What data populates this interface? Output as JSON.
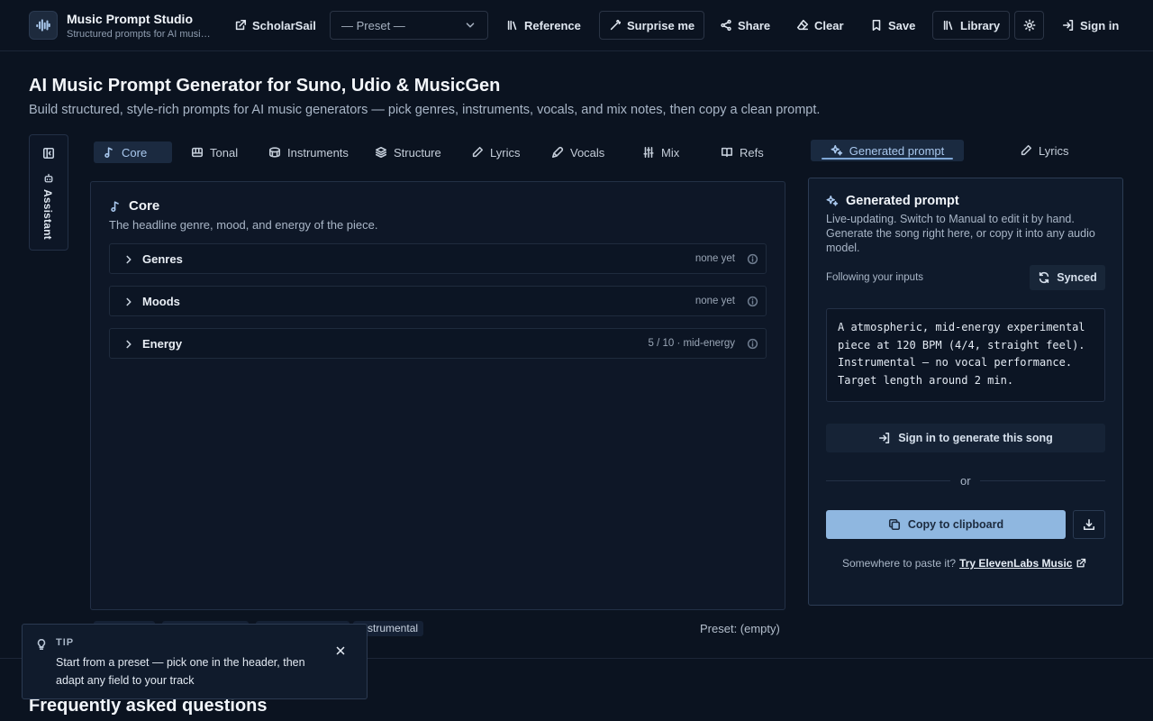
{
  "header": {
    "brand_title": "Music Prompt Studio",
    "brand_subtitle": "Structured prompts for AI music generators",
    "scholarsail_label": "ScholarSail",
    "preset_value": "— Preset —",
    "reference_label": "Reference",
    "surprise_label": "Surprise me",
    "share_label": "Share",
    "clear_label": "Clear",
    "save_label": "Save",
    "library_label": "Library",
    "signin_label": "Sign in"
  },
  "hero": {
    "title": "AI Music Prompt Generator for Suno, Udio & MusicGen",
    "subtitle": "Build structured, style-rich prompts for AI music generators — pick genres, instruments, vocals, and mix notes, then copy a clean prompt."
  },
  "assistant": {
    "label": "Assistant"
  },
  "tabs": [
    {
      "label": "Core",
      "icon": "music-note-icon",
      "active": true
    },
    {
      "label": "Tonal",
      "icon": "piano-icon"
    },
    {
      "label": "Instruments",
      "icon": "drum-icon"
    },
    {
      "label": "Structure",
      "icon": "layers-icon"
    },
    {
      "label": "Lyrics",
      "icon": "pen-icon"
    },
    {
      "label": "Vocals",
      "icon": "mic-icon"
    },
    {
      "label": "Mix",
      "icon": "sliders-icon"
    },
    {
      "label": "Refs",
      "icon": "book-icon"
    }
  ],
  "core": {
    "title": "Core",
    "subtitle": "The headline genre, mood, and energy of the piece.",
    "sections": [
      {
        "label": "Genres",
        "meta": "none yet"
      },
      {
        "label": "Moods",
        "meta": "none yet"
      },
      {
        "label": "Energy",
        "meta": "5 / 10 · mid-energy"
      }
    ]
  },
  "footer_chips": [
    "",
    "",
    "",
    "Instrumental"
  ],
  "preset_status": "Preset: (empty)",
  "right": {
    "generated_tab_label": "Generated prompt",
    "lyrics_tab_label": "Lyrics",
    "title": "Generated prompt",
    "description": "Live-updating. Switch to Manual to edit it by hand. Generate the song right here, or copy it into any audio model.",
    "following_label": "Following your inputs",
    "synced_label": "Synced",
    "prompt_text": "A atmospheric, mid-energy experimental piece at 120 BPM (4/4, straight feel). Instrumental — no vocal performance. Target length around 2 min.",
    "generate_label": "Sign in to generate this song",
    "or_label": "or",
    "copy_label": "Copy to clipboard",
    "paste_prefix": "Somewhere to paste it?",
    "paste_link": "Try ElevenLabs Music"
  },
  "faq": {
    "title": "Frequently asked questions"
  },
  "tip": {
    "label": "TIP",
    "text": "Start from a preset — pick one in the header, then adapt any field to your track"
  },
  "colors": {
    "background": "#0b1320",
    "accent": "#8fb7e0",
    "active_tab": "#1b2a40",
    "panel": "#0e1727"
  }
}
